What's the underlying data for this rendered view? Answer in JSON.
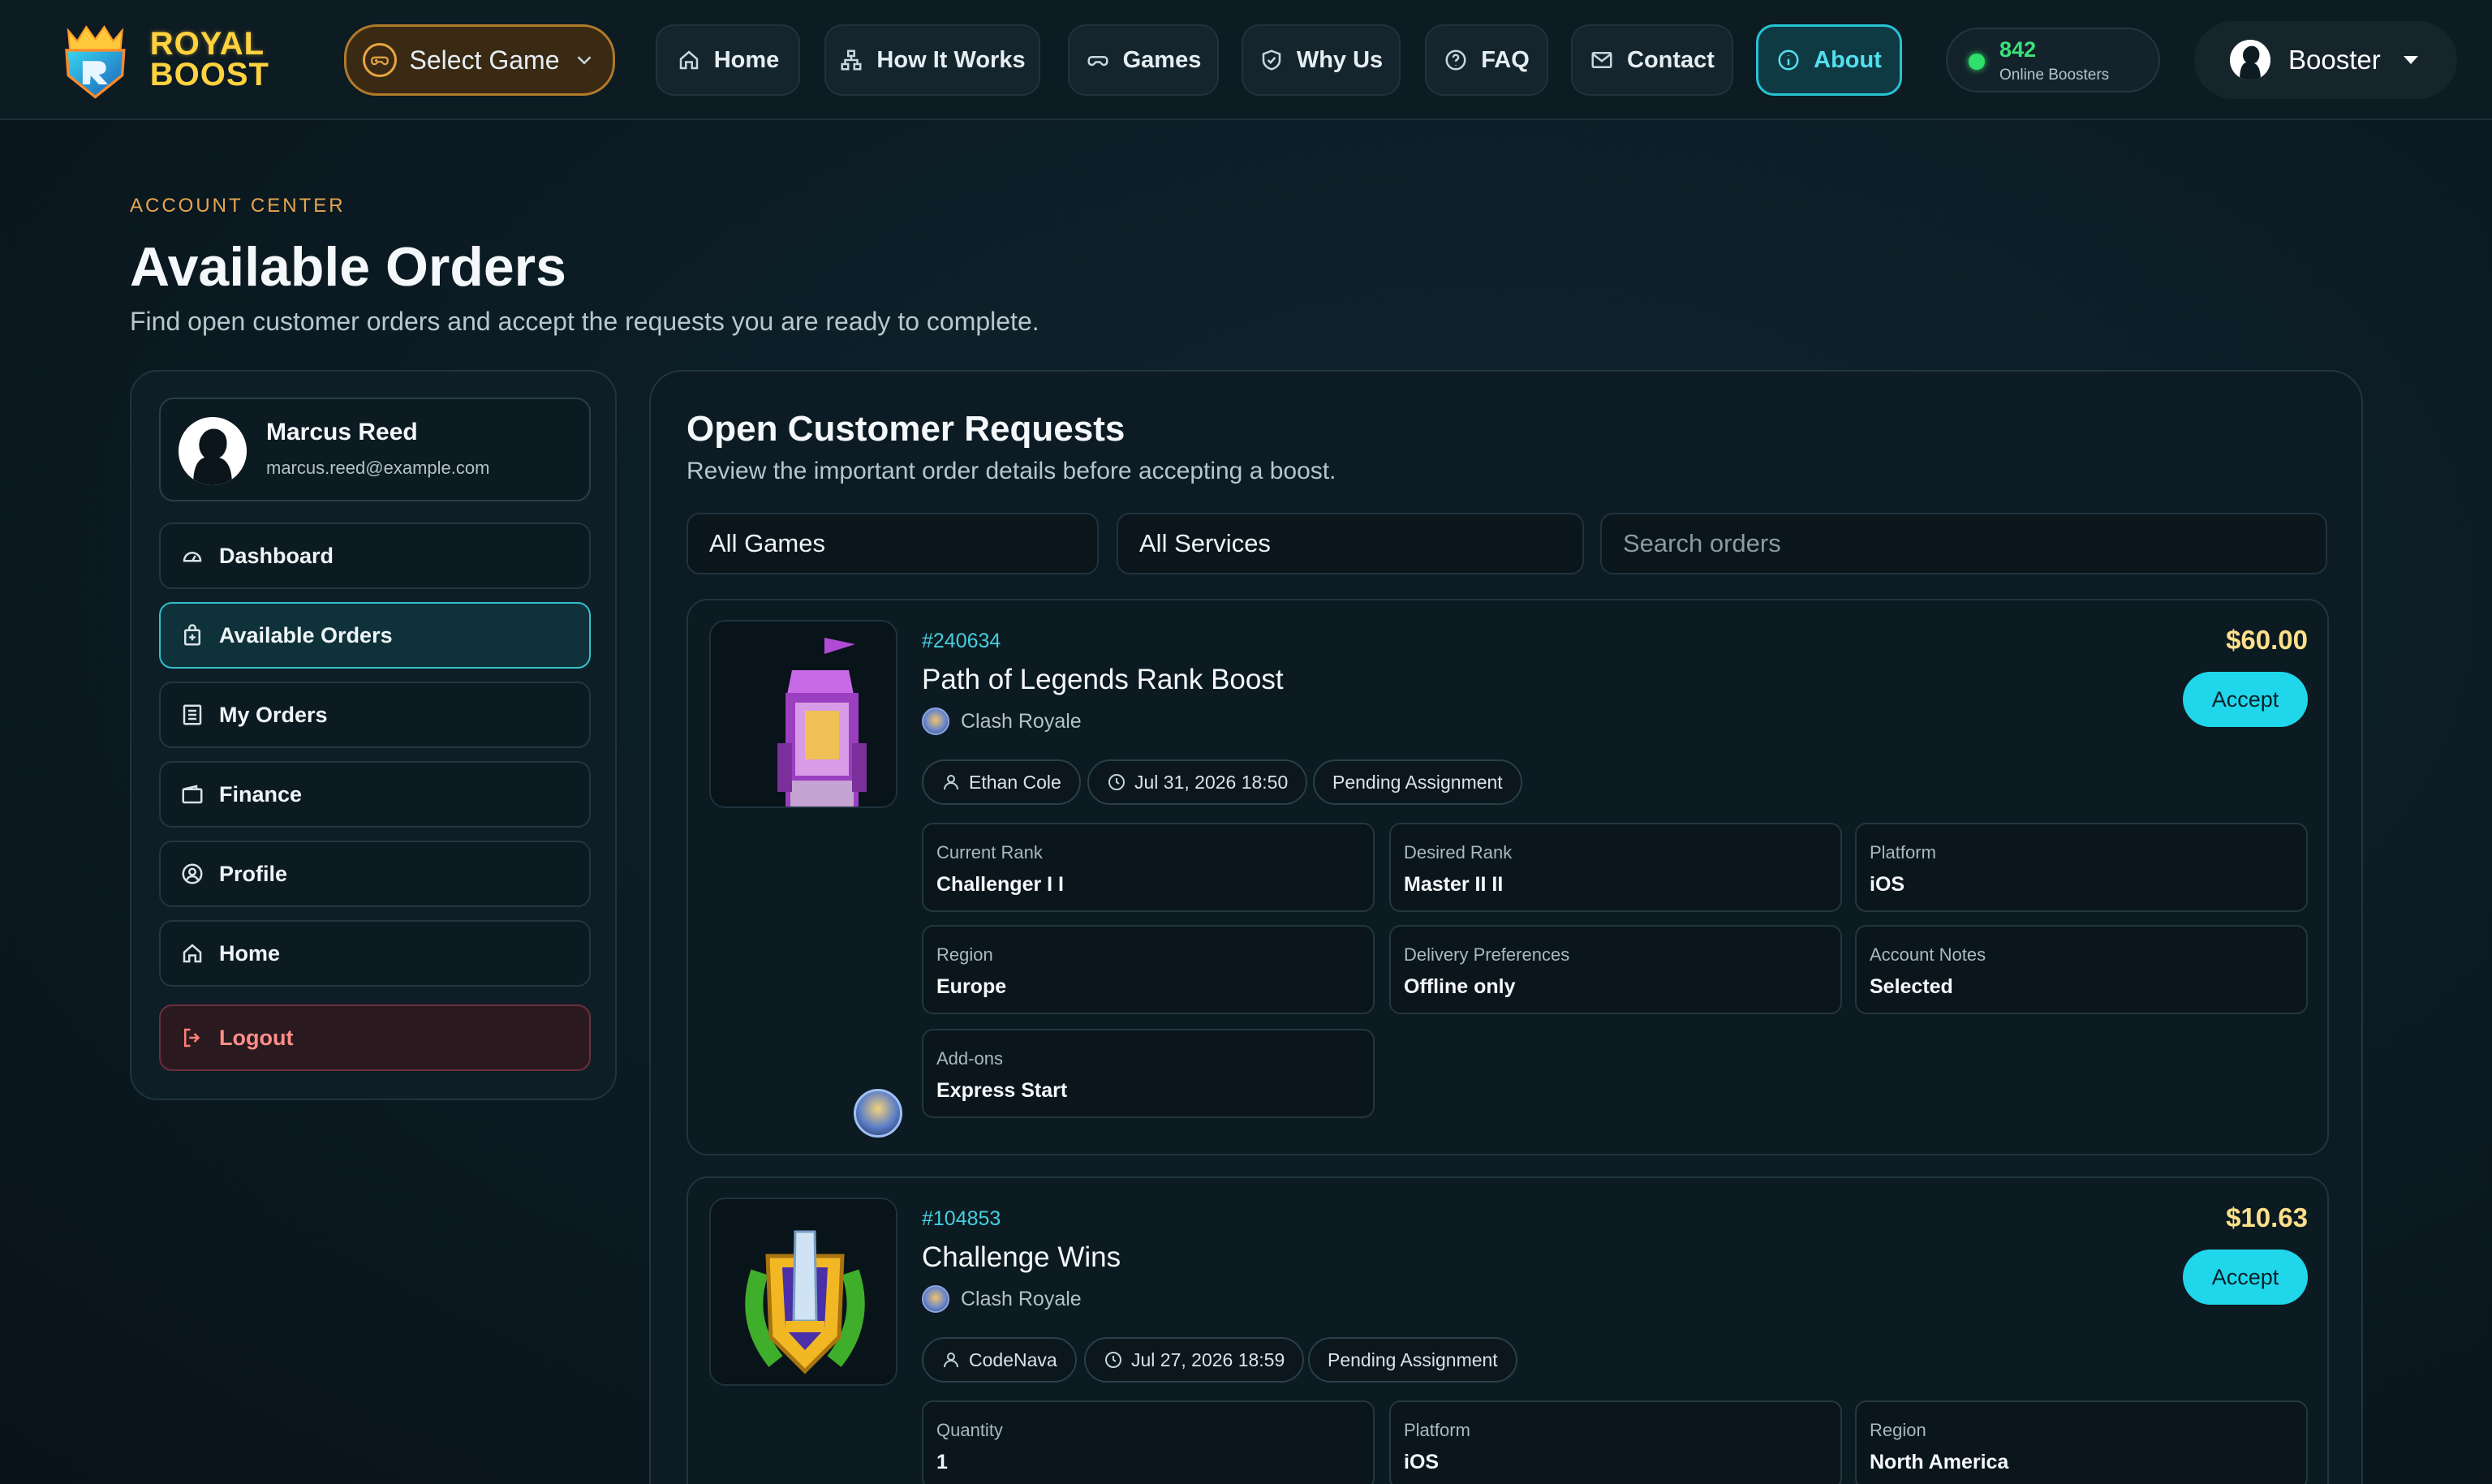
{
  "brand": {
    "line1": "ROYAL",
    "line2": "BOOST"
  },
  "nav": {
    "select_game": "Select Game",
    "home": "Home",
    "how_it_works": "How It Works",
    "games": "Games",
    "why_us": "Why Us",
    "faq": "FAQ",
    "contact": "Contact",
    "about": "About"
  },
  "online": {
    "count": "842",
    "label": "Online Boosters"
  },
  "user_menu": {
    "label": "Booster"
  },
  "header": {
    "eyebrow": "ACCOUNT CENTER",
    "title": "Available Orders",
    "subtitle": "Find open customer orders and accept the requests you are ready to complete."
  },
  "sidebar": {
    "profile": {
      "name": "Marcus Reed",
      "email": "marcus.reed@example.com"
    },
    "items": [
      {
        "label": "Dashboard",
        "icon": "gauge-icon"
      },
      {
        "label": "Available Orders",
        "icon": "bag-plus-icon"
      },
      {
        "label": "My Orders",
        "icon": "list-icon"
      },
      {
        "label": "Finance",
        "icon": "wallet-icon"
      },
      {
        "label": "Profile",
        "icon": "user-circle-icon"
      },
      {
        "label": "Home",
        "icon": "home-icon"
      },
      {
        "label": "Logout",
        "icon": "logout-icon"
      }
    ]
  },
  "panel": {
    "title": "Open Customer Requests",
    "subtitle": "Review the important order details before accepting a boost.",
    "filters": {
      "games": "All Games",
      "services": "All Services",
      "search_placeholder": "Search orders"
    }
  },
  "orders": [
    {
      "id": "#240634",
      "title": "Path of Legends Rank Boost",
      "game": "Clash Royale",
      "price": "$60.00",
      "accept": "Accept",
      "customer": "Ethan Cole",
      "date": "Jul 31, 2026 18:50",
      "status": "Pending Assignment",
      "fields": [
        {
          "label": "Current Rank",
          "value": "Challenger I I"
        },
        {
          "label": "Desired Rank",
          "value": "Master II II"
        },
        {
          "label": "Platform",
          "value": "iOS"
        },
        {
          "label": "Region",
          "value": "Europe"
        },
        {
          "label": "Delivery Preferences",
          "value": "Offline only"
        },
        {
          "label": "Account Notes",
          "value": "Selected"
        },
        {
          "label": "Add-ons",
          "value": "Express Start"
        }
      ]
    },
    {
      "id": "#104853",
      "title": "Challenge Wins",
      "game": "Clash Royale",
      "price": "$10.63",
      "accept": "Accept",
      "customer": "CodeNava",
      "date": "Jul 27, 2026 18:59",
      "status": "Pending Assignment",
      "fields": [
        {
          "label": "Quantity",
          "value": "1"
        },
        {
          "label": "Platform",
          "value": "iOS"
        },
        {
          "label": "Region",
          "value": "North America"
        }
      ]
    }
  ],
  "colors": {
    "accent": "#20d6ea",
    "price": "#ffe08a",
    "online": "#3be27b",
    "eyebrow": "#e6a650",
    "logout": "#ff8f88"
  }
}
